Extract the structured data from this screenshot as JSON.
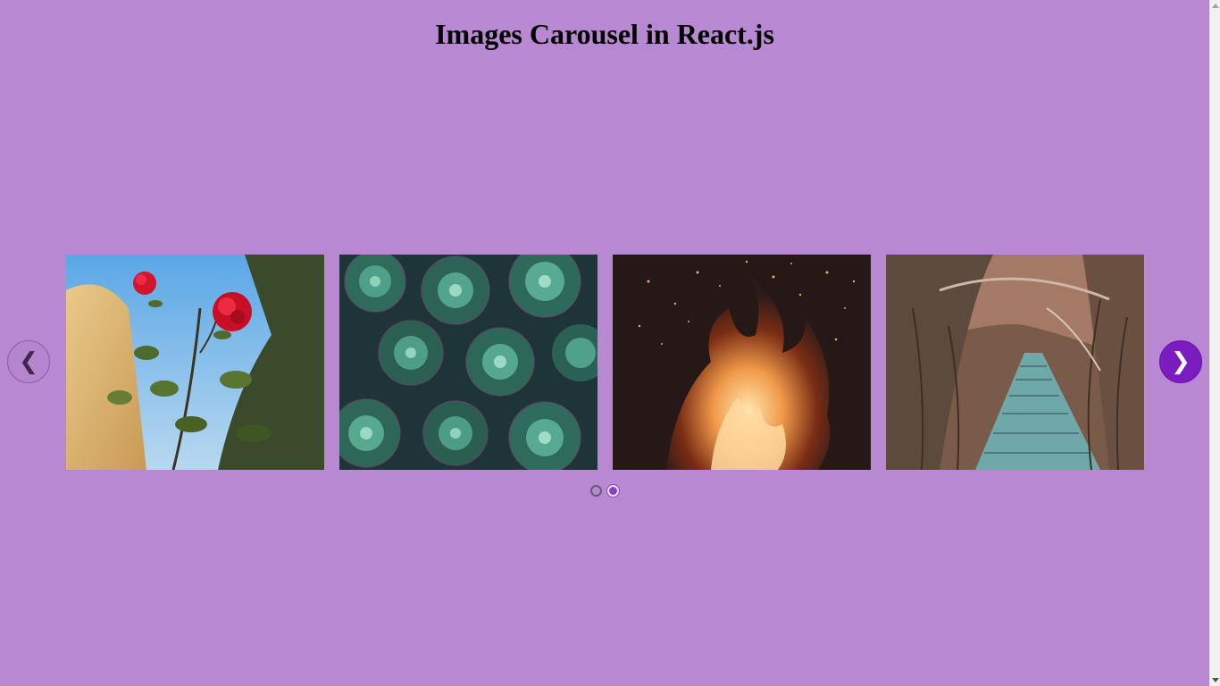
{
  "title": "Images Carousel in React.js",
  "nav": {
    "prev_label": "❮",
    "next_label": "❯"
  },
  "slides": [
    {
      "name": "red-roses",
      "icon": "rose-image"
    },
    {
      "name": "succulents",
      "icon": "succulent-image"
    },
    {
      "name": "campfire",
      "icon": "fire-image"
    },
    {
      "name": "forest-boardwalk",
      "icon": "boardwalk-image"
    }
  ],
  "pagination": {
    "count": 2,
    "active_index": 1
  },
  "colors": {
    "background": "#b888d2",
    "active_accent": "#7a1cc0"
  }
}
